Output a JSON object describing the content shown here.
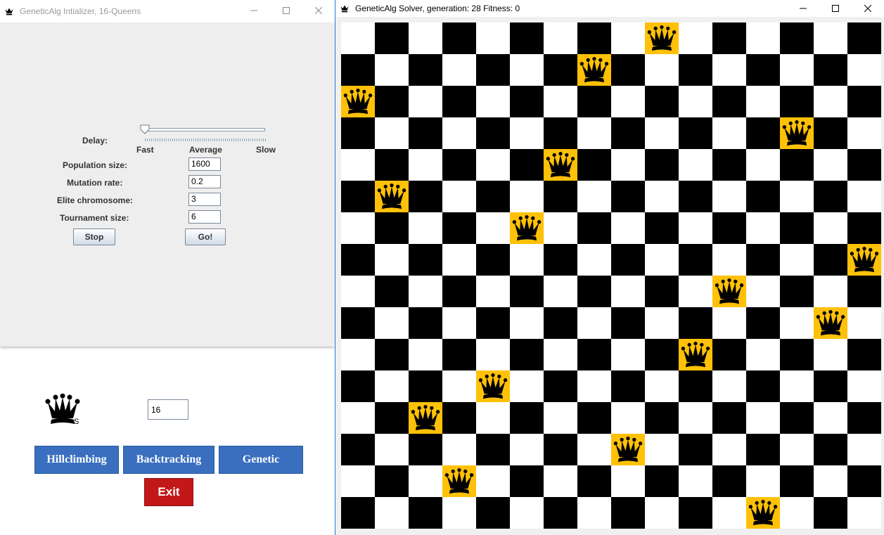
{
  "init_window": {
    "title": "GeneticAlg Intializer, 16-Queens",
    "delay_label": "Delay:",
    "slider_labels": [
      "Fast",
      "Average",
      "Slow"
    ],
    "slider_position": 0,
    "fields": [
      {
        "label": "Population size:",
        "value": "1600"
      },
      {
        "label": "Mutation rate:",
        "value": "0.2"
      },
      {
        "label": "Elite chromosome:",
        "value": "3"
      },
      {
        "label": "Tournament size:",
        "value": "6"
      }
    ],
    "stop_label": "Stop",
    "go_label": "Go!"
  },
  "main_menu": {
    "logo_suffix": "S",
    "board_size": "16",
    "buttons": [
      "Hillclimbing",
      "Backtracking",
      "Genetic"
    ],
    "exit_label": "Exit"
  },
  "solver_window": {
    "title": "GeneticAlg Solver, generation: 28 Fitness: 0",
    "board_size": 16,
    "queen_columns_by_row": [
      9,
      7,
      0,
      13,
      6,
      1,
      5,
      15,
      11,
      14,
      10,
      4,
      2,
      8,
      3,
      12
    ],
    "queen_highlight_color": "#ffc107"
  }
}
